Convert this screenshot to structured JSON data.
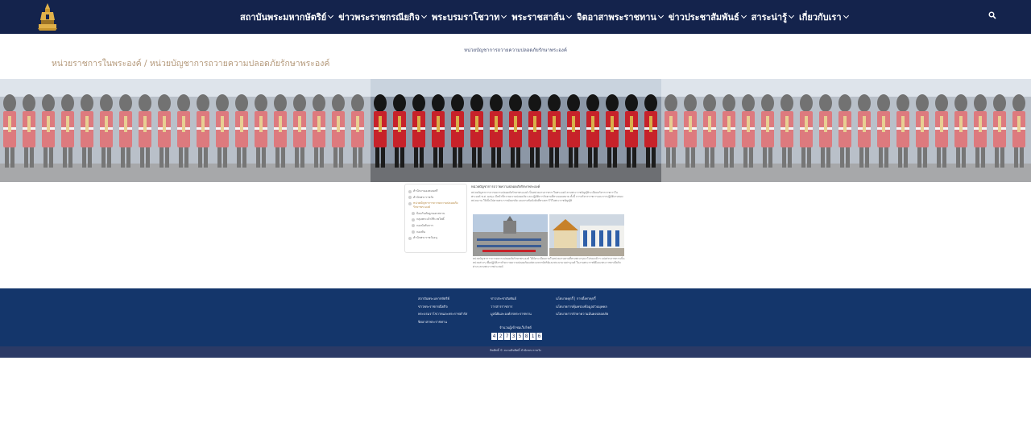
{
  "nav": {
    "items": [
      {
        "label": "สถาบันพระมหากษัตริย์"
      },
      {
        "label": "ข่าวพระราชกรณียกิจ"
      },
      {
        "label": "พระบรมราโชวาท"
      },
      {
        "label": "พระราชสาส์น"
      },
      {
        "label": "จิตอาสาพระราชทาน"
      },
      {
        "label": "ข่าวประชาสัมพันธ์"
      },
      {
        "label": "สาระน่ารู้"
      },
      {
        "label": "เกี่ยวกับเรา"
      }
    ],
    "logo_icon": "royal-emblem-icon",
    "search_icon": "search-icon"
  },
  "page": {
    "small_title": "หน่วยบัญชาการถวายความปลอดภัยรักษาพระองค์",
    "breadcrumb": "หน่วยราชการในพระองค์ / หน่วยบัญชาการถวายความปลอดภัยรักษาพระองค์"
  },
  "sidebar": {
    "items": [
      {
        "label": "สำนักงานองคมนตรี",
        "sub": false,
        "active": false
      },
      {
        "label": "สำนักพระราชวัง",
        "sub": false,
        "active": false
      },
      {
        "label": "หน่วยบัญชาการถวายความปลอดภัยรักษาพระองค์",
        "sub": false,
        "active": true
      },
      {
        "label": "ป้องกันภัยลูกนอกสถาน",
        "sub": true,
        "active": false
      },
      {
        "label": "กลุ่มพระเจ้าสิริเวชโพธิ์",
        "sub": true,
        "active": false
      },
      {
        "label": "กองบังคับการ",
        "sub": true,
        "active": false
      },
      {
        "label": "กองพัน",
        "sub": true,
        "active": false
      },
      {
        "label": "สำนักพระราชวังอนุ",
        "sub": false,
        "active": false
      }
    ]
  },
  "article": {
    "title": "หน่วยบัญชาการถวายความปลอดภัยรักษาพระองค์",
    "para1": "หน่วยบัญชาการถวายความปลอดภัยรักษาพระองค์ เป็นหน่วยงานราชการในพระองค์ ตามพระราชบัญญัติระเบียบบริหารราชการในพระองค์ พ.ศ. ๒๕๖๐ มีหน้าที่ถวายความปลอดภัย และปฏิบัติภารกิจตามที่ทรงมอบหมาย ทั้งนี้ การบริหารราชการและการปฏิบัติงานของหน่วยงาน ให้เป็นไปตามพระราชอัธยาศัย และตามข้อบังคับที่ทรงตราไว้ในพระราชบัญญัติ",
    "para2": "หน่วยบัญชาการถวายความปลอดภัยรักษาพระองค์ ได้จัดระเบียบภายในหน่วยงานตามที่ทรงพระกรุณาโปรดเกล้าฯ แบ่งส่วนราชการเป็นหน่วยต่างๆ เพื่อปฏิบัติภารกิจถวายความปลอดภัยแด่พระมหากษัตริย์และพระบรมวงศานุวงศ์ ในงานพระราชพิธีและพระราชกรณียกิจต่างๆ ตามพระราชประสงค์"
  },
  "footer": {
    "col1": [
      "สถาบันพระมหากษัตริย์",
      "ข่าวพระราชกรณียกิจ",
      "พระบรมราโชวาทและพระราชดำรัส",
      "จิตอาสาพระราชทาน"
    ],
    "col2": [
      "ข่าวประชาสัมพันธ์",
      "วารสารราชการ",
      "มูลนิธิและองค์กรพระราชทาน"
    ],
    "col3": [
      "นโยบายคุกกี้  |  การตั้งค่าคุกกี้",
      "นโยบายการคุ้มครองข้อมูลส่วนบุคคล",
      "นโยบายการรักษาความมั่นคงปลอดภัย"
    ],
    "counter_label": "จำนวนผู้เข้าชมเว็บไซต์",
    "counter_digits": [
      "4",
      "2",
      "7",
      "3",
      "5",
      "8",
      "1",
      "6"
    ],
    "copyright": "ลิขสิทธิ์ © สงวนลิขสิทธิ์ สำนักพระราชวัง"
  },
  "colors": {
    "nav_bg": "#14234c",
    "footer_bg": "#14366b",
    "breadcrumb": "#b59a7c",
    "guard_red": "#c7222a",
    "active_link": "#b5873f"
  }
}
